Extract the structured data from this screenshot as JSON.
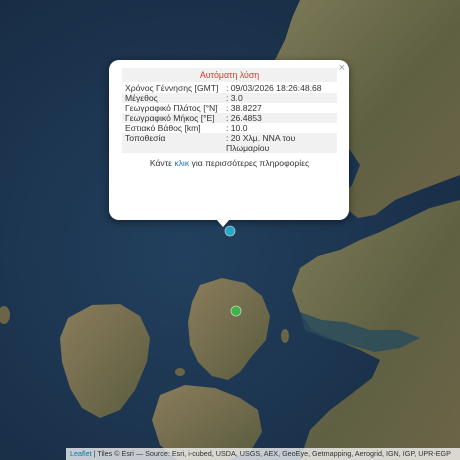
{
  "popup": {
    "title": "Αυτόματη λύση",
    "close_glyph": "×",
    "rows": [
      {
        "label": "Χρόνος Γέννησης [GMT]",
        "value": "09/03/2026 18:26:48.68"
      },
      {
        "label": "Μέγεθος",
        "value": "3.0"
      },
      {
        "label": "Γεωγραφικό Πλάτος [°N]",
        "value": "38.8227"
      },
      {
        "label": "Γεωγραφικό Μήκος [°E]",
        "value": "26.4853"
      },
      {
        "label": "Εστιακό Βάθος [km]",
        "value": "10.0"
      },
      {
        "label": "Τοποθεσία",
        "value": "20 Χλμ. ΝΝΑ του Πλωμαρίου"
      }
    ],
    "more_prefix": "Κάντε",
    "more_link": "κλικ",
    "more_suffix": "για περισσότερες πληροφορίες"
  },
  "attribution": {
    "leaflet": "Leaflet",
    "text": " | Tiles © Esri — Source: Esri, i-cubed, USDA, USGS, AEX, GeoEye, Getmapping, Aerogrid, IGN, IGP, UPR-EGP"
  },
  "markers": {
    "epicenter_color": "#2aa8c8",
    "station_color": "#3fb24a"
  },
  "colors": {
    "sea": "#1d3550",
    "land": "#6e6a4c",
    "title": "#e0352b",
    "link": "#1a73c8"
  }
}
